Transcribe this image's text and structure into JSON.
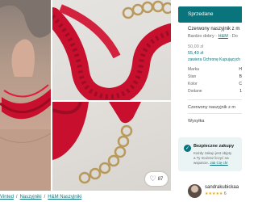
{
  "gallery": {
    "favourite_count": "87",
    "photos": [
      "necklace-worn-photo",
      "necklace-on-table-photo",
      "clasp-chain-photo"
    ]
  },
  "breadcrumb": [
    "Vinted",
    "Naszyjniki",
    "H&M Naszyjniki"
  ],
  "item": {
    "status": "Sprzedane",
    "title": "Czerwony naszyjnik z m",
    "condition": "Bardzo dobry",
    "meta_sep": "·",
    "brand": "H&M",
    "meta_tail": "· Do",
    "price_original": "50,00 zł",
    "price_total": "55,40 zł",
    "protection_note": "zawiera Ochronę Kupujących",
    "attributes": [
      {
        "label": "Marka",
        "value": "H"
      },
      {
        "label": "Stan",
        "value": "B"
      },
      {
        "label": "Kolor",
        "value": "C"
      },
      {
        "label": "Dodane",
        "value": "1"
      }
    ],
    "description": "Czerwony naszyjnik z m",
    "shipping_label": "Wysyłka"
  },
  "safe_purchase": {
    "title": "Bezpieczne zakupy",
    "line1": "Każdy zakup jest objęty",
    "line2": "a Ty możesz liczyć na",
    "line3_prefix": "wsparcie.",
    "line3_link": "Jak Cię chr"
  },
  "seller": {
    "name": "sandrakubickaa",
    "stars": "★★★★★",
    "reviews": "6"
  },
  "colors": {
    "accent": "#09747b",
    "necklace": "#c8102e"
  }
}
